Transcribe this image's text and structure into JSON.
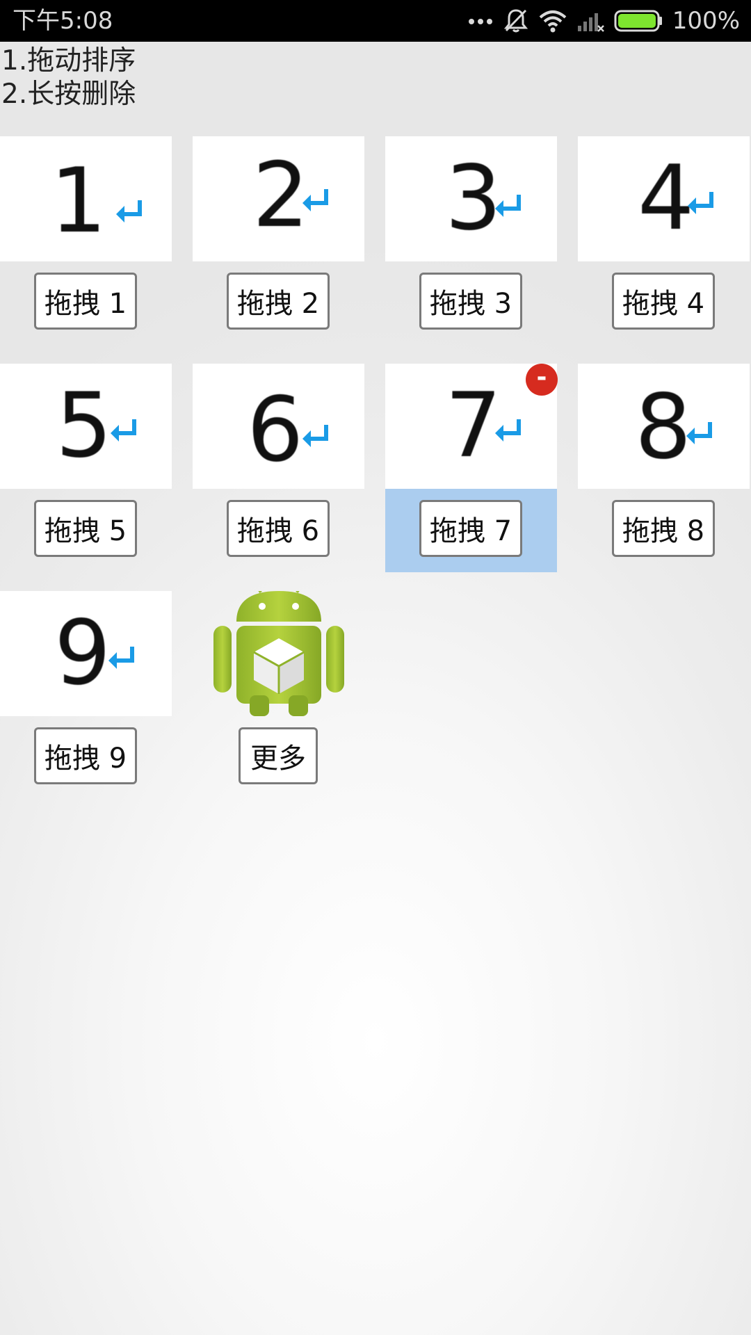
{
  "status_bar": {
    "time": "下午5:08",
    "battery_percent": "100%",
    "icons": [
      "more-dots-icon",
      "silent-bell-icon",
      "wifi-icon",
      "signal-icon",
      "battery-icon"
    ],
    "battery_color": "#7ee52f"
  },
  "instructions": {
    "line1": "1.拖动排序",
    "line2": "2.长按删除"
  },
  "grid": {
    "items": [
      {
        "digit": "1",
        "label": "拖拽 1"
      },
      {
        "digit": "2",
        "label": "拖拽 2"
      },
      {
        "digit": "3",
        "label": "拖拽 3"
      },
      {
        "digit": "4",
        "label": "拖拽 4"
      },
      {
        "digit": "5",
        "label": "拖拽 5"
      },
      {
        "digit": "6",
        "label": "拖拽 6"
      },
      {
        "digit": "7",
        "label": "拖拽 7"
      },
      {
        "digit": "8",
        "label": "拖拽 8"
      },
      {
        "digit": "9",
        "label": "拖拽 9"
      },
      {
        "label": "更多",
        "icon": "android-package-icon"
      }
    ],
    "selected_item": "拖拽 7",
    "selected_color": "#abcdef",
    "delete_badge": "-",
    "delete_badge_color": "#d62b1f",
    "return_arrow_color": "#1a9be6"
  }
}
